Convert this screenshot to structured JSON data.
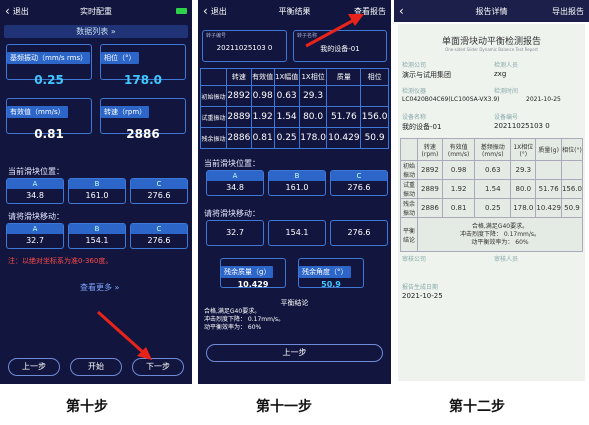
{
  "p1": {
    "back": "退出",
    "title": "实时配重",
    "data_list": "数据列表",
    "metrics": [
      {
        "label": "基频振动（mm/s rms）",
        "value": "0.25"
      },
      {
        "label": "相位（°）",
        "value": "178.0"
      },
      {
        "label": "有效值（mm/s）",
        "value": "0.81"
      },
      {
        "label": "转速（rpm）",
        "value": "2886"
      }
    ],
    "current_pos_title": "当前滑块位置：",
    "current_pos": [
      {
        "h": "A",
        "v": "34.8"
      },
      {
        "h": "B",
        "v": "161.0"
      },
      {
        "h": "C",
        "v": "276.6"
      }
    ],
    "move_title": "请将滑块移动：",
    "move": [
      {
        "h": "A",
        "v": "32.7"
      },
      {
        "h": "B",
        "v": "154.1"
      },
      {
        "h": "C",
        "v": "276.6"
      }
    ],
    "note": "注：以绝对坐标系为准0-360度。",
    "more": "查看更多",
    "buttons": {
      "prev": "上一步",
      "start": "开始",
      "next": "下一步"
    }
  },
  "p2": {
    "back": "退出",
    "title": "平衡结果",
    "action": "查看报告",
    "field1_label": "转子编号",
    "field1_value": "20211025103 0",
    "field2_label": "转子名称",
    "field2_value": "我的设备-01",
    "table": {
      "headers": [
        "",
        "转速",
        "有效值",
        "1X幅值",
        "1X相位",
        "质量",
        "相位"
      ],
      "rows": [
        [
          "初始振动",
          "2892",
          "0.98",
          "0.63",
          "29.3",
          "",
          ""
        ],
        [
          "试重振动",
          "2889",
          "1.92",
          "1.54",
          "80.0",
          "51.76",
          "156.0"
        ],
        [
          "残余振动",
          "2886",
          "0.81",
          "0.25",
          "178.0",
          "10.429",
          "50.9"
        ]
      ]
    },
    "current_pos_title": "当前滑块位置：",
    "current_pos": [
      {
        "h": "A",
        "v": "34.8"
      },
      {
        "h": "B",
        "v": "161.0"
      },
      {
        "h": "C",
        "v": "276.6"
      }
    ],
    "move_title": "请将滑块移动：",
    "move": [
      {
        "h": "",
        "v": "32.7"
      },
      {
        "h": "",
        "v": "154.1"
      },
      {
        "h": "",
        "v": "276.6"
      }
    ],
    "residual_mass_label": "残余质量（g）",
    "residual_mass_value": "10.429",
    "residual_angle_label": "残余角度（°）",
    "residual_angle_value": "50.9",
    "conclusion_title": "平衡结论",
    "conclusion_lines": [
      "合格,满足G40要求。",
      "冲击烈度下降： 0.17mm/s。",
      "动平衡效率为： 60%"
    ],
    "prev": "上一步"
  },
  "p3": {
    "title": "报告详情",
    "action": "导出报告",
    "doc_title": "单面滑块动平衡检测报告",
    "doc_subtitle": "One-sided Slider Dynamic Balance Test Report",
    "label_company": "检测公司",
    "label_person": "检测人员",
    "company": "演示与试用集团",
    "person": "zxg",
    "label_instrument": "检测仪器",
    "label_time": "检测时间",
    "instrument": "LC0420B04C69(LC100SA-VX3.9)",
    "time": "2021-10-25",
    "label_device_name": "设备名称",
    "label_device_no": "设备编号",
    "device_name": "我的设备-01",
    "device_no": "20211025103 0",
    "table": {
      "headers": [
        "",
        "转速(rpm)",
        "有效值(mm/s)",
        "基频振动(mm/s)",
        "1X相位(°)",
        "质量(g)",
        "相位(°)"
      ],
      "rows": [
        [
          "初始振动",
          "2892",
          "0.98",
          "0.63",
          "29.3",
          "",
          ""
        ],
        [
          "试重振动",
          "2889",
          "1.92",
          "1.54",
          "80.0",
          "51.76",
          "156.0"
        ],
        [
          "残余振动",
          "2886",
          "0.81",
          "0.25",
          "178.0",
          "10.429",
          "50.9"
        ]
      ]
    },
    "conclusion_label": "平衡结论",
    "conclusion_lines": [
      "合格,满足G40要求。",
      "冲击烈度下降： 0.17mm/s。",
      "动平衡效率为： 60%"
    ],
    "label_audit_company": "审核公司",
    "label_audit_person": "审核人员",
    "label_date": "报告生成日期",
    "date": "2021-10-25"
  },
  "steps": [
    "第十步",
    "第十一步",
    "第十二步"
  ],
  "colors": {
    "bg": "#12163e",
    "accent": "#2c66c9",
    "cyan": "#40c7ff",
    "arrow": "#e8241a"
  }
}
